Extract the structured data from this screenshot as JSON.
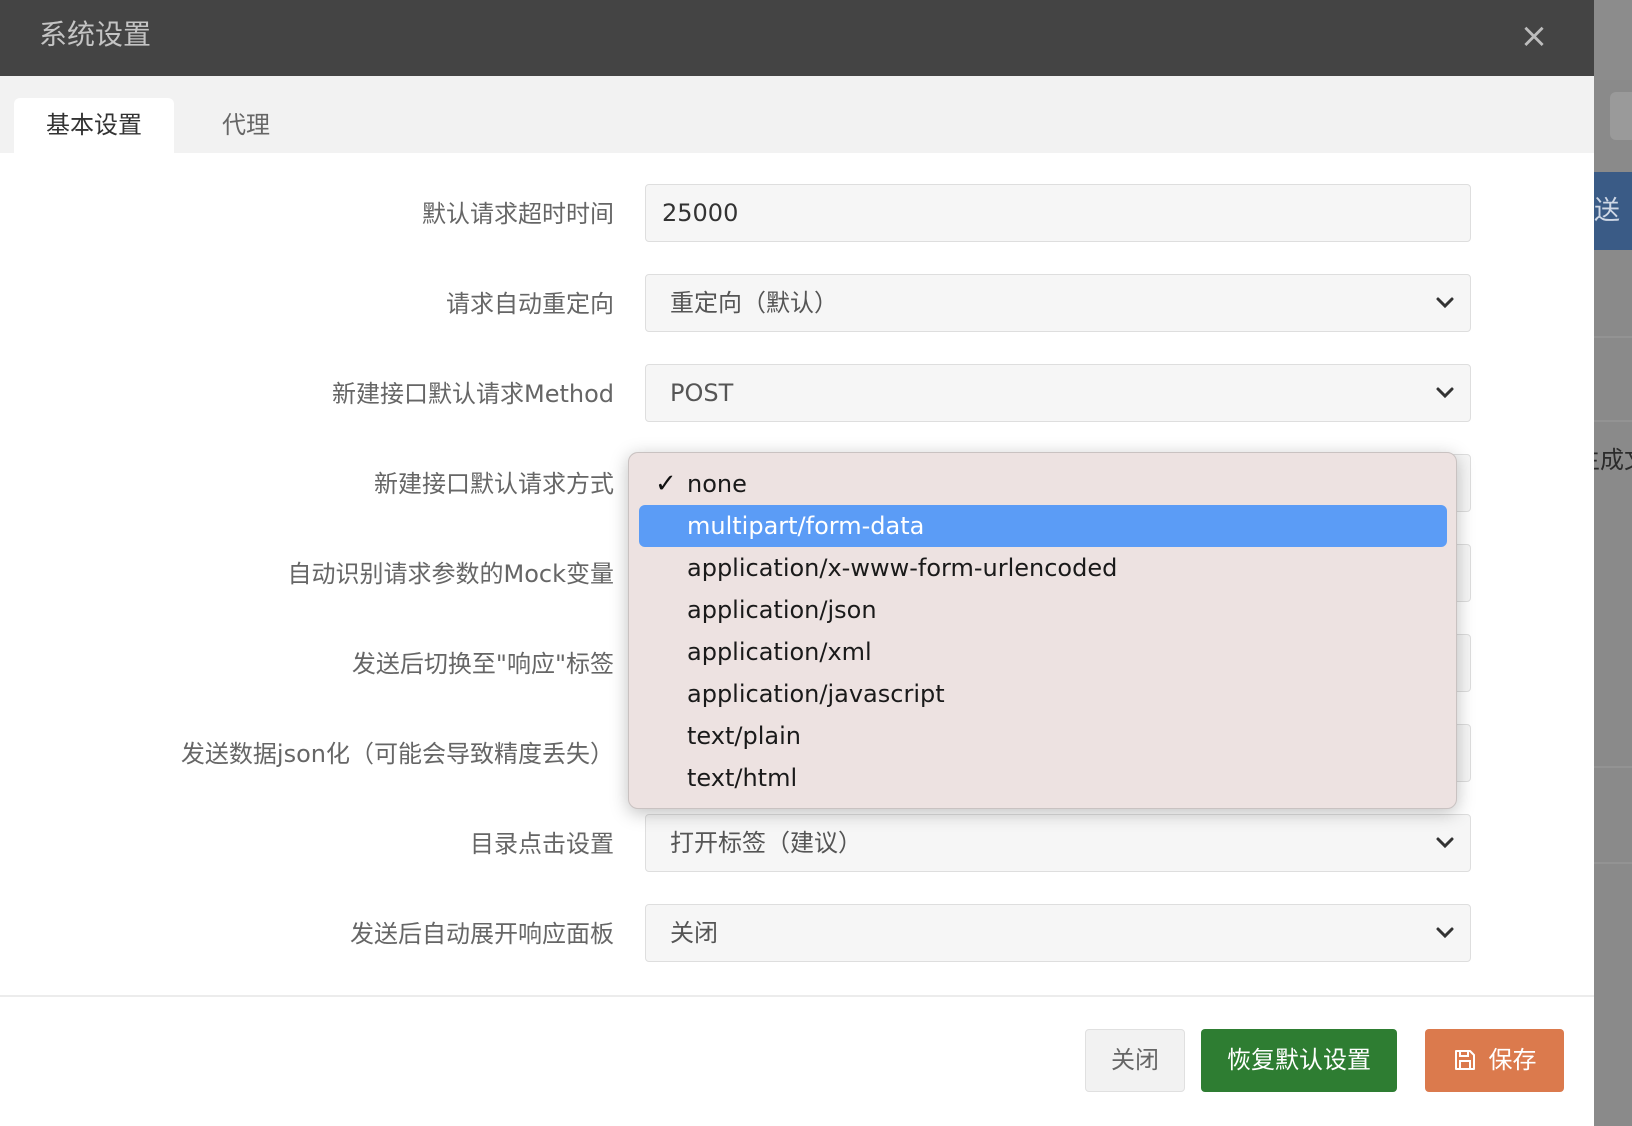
{
  "modal": {
    "title": "系统设置",
    "close_icon": "×"
  },
  "tabs": [
    {
      "label": "基本设置",
      "active": true
    },
    {
      "label": "代理",
      "active": false
    }
  ],
  "form": {
    "rows": [
      {
        "label": "默认请求超时时间",
        "value": "25000",
        "type": "input"
      },
      {
        "label": "请求自动重定向",
        "value": "重定向（默认）",
        "type": "select"
      },
      {
        "label": "新建接口默认请求Method",
        "value": "POST",
        "type": "select"
      },
      {
        "label": "新建接口默认请求方式",
        "value": "none",
        "type": "select"
      },
      {
        "label": "自动识别请求参数的Mock变量",
        "value": "",
        "type": "select"
      },
      {
        "label": "发送后切换至\"响应\"标签",
        "value": "",
        "type": "select"
      },
      {
        "label": "发送数据json化（可能会导致精度丢失）",
        "value": "",
        "type": "select"
      },
      {
        "label": "目录点击设置",
        "value": "打开标签（建议）",
        "type": "select"
      },
      {
        "label": "发送后自动展开响应面板",
        "value": "关闭",
        "type": "select"
      }
    ]
  },
  "dropdown": {
    "check_mark": "✓",
    "selected": "none",
    "highlighted": "multipart/form-data",
    "options": [
      "none",
      "multipart/form-data",
      "application/x-www-form-urlencoded",
      "application/json",
      "application/xml",
      "application/javascript",
      "text/plain",
      "text/html"
    ]
  },
  "footer": {
    "close_label": "关闭",
    "reset_label": "恢复默认设置",
    "save_label": "保存"
  },
  "background": {
    "partial_text": "生成文",
    "partial_blue_text": "送"
  },
  "colors": {
    "header_bg": "#444444",
    "reset_button": "#2e7d32",
    "save_button": "#db7a4d",
    "dropdown_highlight": "#5b9cf6"
  }
}
